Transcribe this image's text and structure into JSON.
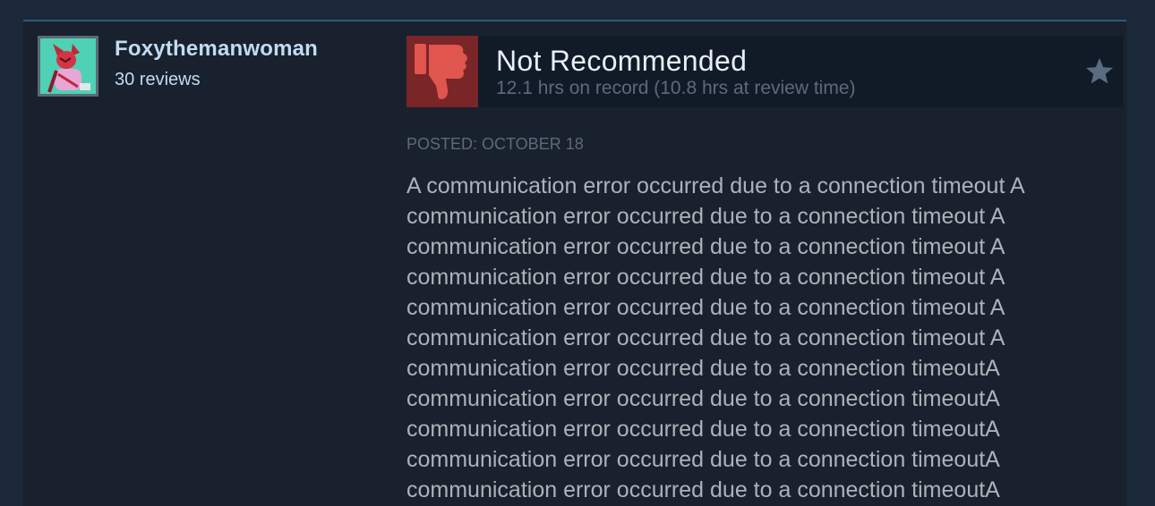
{
  "author": {
    "name": "Foxythemanwoman",
    "reviews": "30 reviews"
  },
  "review": {
    "verdict": "Not Recommended",
    "hours": "12.1 hrs on record (10.8 hrs at review time)",
    "posted": "POSTED: OCTOBER 18",
    "body_lines": [
      "A communication error occurred due to a connection timeout A",
      "communication error occurred due to a connection timeout A",
      "communication error occurred due to a connection timeout A",
      "communication error occurred due to a connection timeout A",
      "communication error occurred due to a connection timeout A",
      "communication error occurred due to a connection timeout A",
      "communication error occurred due to a connection timeoutA",
      "communication error occurred due to a connection timeoutA",
      "communication error occurred due to a connection timeoutA",
      "communication error occurred due to a connection timeoutA",
      "communication error occurred due to a connection timeoutA"
    ]
  },
  "icons": {
    "thumb": "thumbs-down-icon",
    "star": "star-icon",
    "avatar": "avatar-image"
  },
  "colors": {
    "background": "#1b2838",
    "card": "#18212d",
    "accent_border": "#2f5a78",
    "author_text": "#c1dbf4",
    "thumb_bg": "#7a2528",
    "thumb_fg": "#e0554e",
    "body_text": "#acb2b8",
    "muted_text": "#5d6a79"
  }
}
